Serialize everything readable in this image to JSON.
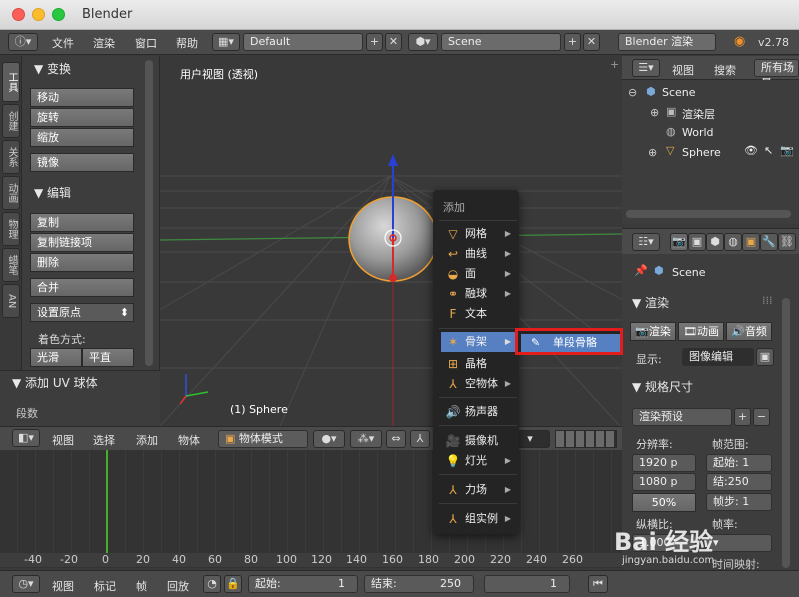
{
  "window": {
    "title": "Blender"
  },
  "topbar": {
    "menus": [
      "文件",
      "渲染",
      "窗口",
      "帮助"
    ],
    "layout": "Default",
    "scene": "Scene",
    "engine": "Blender 渲染",
    "version": "v2.78"
  },
  "toolshelf": {
    "tabs": [
      "工具",
      "创建",
      "关系",
      "动画",
      "物理",
      "蜡笔",
      "AN"
    ],
    "transform_header": "变换",
    "transform_buttons": [
      "移动",
      "旋转",
      "缩放"
    ],
    "mirror": "镜像",
    "edit_header": "编辑",
    "edit_buttons": [
      "复制",
      "复制链接项",
      "删除"
    ],
    "join": "合并",
    "origin": "设置原点",
    "shading_label": "着色方式:",
    "smooth": "光滑",
    "flat": "平直",
    "op_header": "添加 UV 球体",
    "segments": "段数"
  },
  "viewport": {
    "label": "用户视图 (透视)",
    "object_label": "(1) Sphere",
    "header": {
      "menus": [
        "视图",
        "选择",
        "添加",
        "物体"
      ],
      "mode": "物体模式"
    }
  },
  "context_menu": {
    "title": "添加",
    "items": [
      {
        "label": "网格",
        "icon": "mesh-icon",
        "arrow": true
      },
      {
        "label": "曲线",
        "icon": "curve-icon",
        "arrow": true
      },
      {
        "label": "面",
        "icon": "surface-icon",
        "arrow": true
      },
      {
        "label": "融球",
        "icon": "metaball-icon",
        "arrow": true
      },
      {
        "label": "文本",
        "icon": "text-icon",
        "arrow": false
      },
      {
        "label": "骨架",
        "icon": "armature-icon",
        "arrow": true
      },
      {
        "label": "晶格",
        "icon": "lattice-icon",
        "arrow": false
      },
      {
        "label": "空物体",
        "icon": "empty-icon",
        "arrow": true
      },
      {
        "label": "扬声器",
        "icon": "speaker-icon",
        "arrow": false
      },
      {
        "label": "摄像机",
        "icon": "camera-icon",
        "arrow": false
      },
      {
        "label": "灯光",
        "icon": "lamp-icon",
        "arrow": true
      },
      {
        "label": "力场",
        "icon": "forcefield-icon",
        "arrow": true
      },
      {
        "label": "组实例",
        "icon": "group-icon",
        "arrow": true
      }
    ],
    "submenu_item": "单段骨骼"
  },
  "outliner": {
    "menus": [
      "视图",
      "搜索"
    ],
    "filter": "所有场景",
    "tree": [
      "Scene",
      "渲染层",
      "World",
      "Sphere"
    ]
  },
  "properties": {
    "context": "Scene",
    "render_header": "渲染",
    "render_btn": "渲染",
    "anim_btn": "动画",
    "audio_btn": "音频",
    "display_label": "显示:",
    "display_value": "图像编辑",
    "dimensions_header": "规格尺寸",
    "preset": "渲染预设",
    "resolution_label": "分辨率:",
    "frame_range_label": "帧范围:",
    "res_x": "1920 p",
    "res_y": "1080 p",
    "res_pct": "50%",
    "start": "起始: 1",
    "end": "结:250",
    "step": "帧步: 1",
    "aspect_label": "纵横比:",
    "aspect_x": "1.000",
    "frame_rate_label": "帧率:",
    "time_remap": "时间映射:"
  },
  "timeline": {
    "ruler": [
      "-40",
      "-20",
      "0",
      "20",
      "40",
      "60",
      "80",
      "100",
      "120",
      "140",
      "160",
      "180",
      "200",
      "220",
      "240",
      "260"
    ],
    "menus": [
      "视图",
      "标记",
      "帧",
      "回放"
    ],
    "start_label": "起始:",
    "start_value": "1",
    "end_label": "结束:",
    "end_value": "250",
    "current": "1"
  },
  "watermark": {
    "text": "Bai 经验",
    "sub": "jingyan.baidu.com"
  }
}
